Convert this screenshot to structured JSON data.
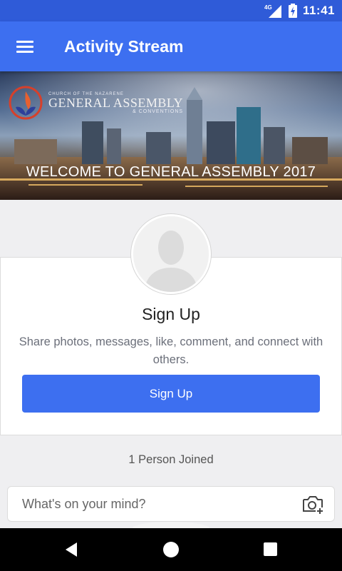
{
  "status_bar": {
    "network": "4G",
    "time": "11:41"
  },
  "app_bar": {
    "title": "Activity Stream",
    "menu_icon": "hamburger-menu-icon"
  },
  "banner": {
    "logo_top": "CHURCH OF THE NAZARENE",
    "logo_main": "GENERAL ASSEMBLY",
    "logo_sub": "& CONVENTIONS",
    "headline": "WELCOME TO GENERAL ASSEMBLY 2017"
  },
  "signup_card": {
    "title": "Sign Up",
    "description": "Share photos, messages, like, comment, and connect with others.",
    "button_label": "Sign Up"
  },
  "joined_text": "1 Person Joined",
  "composer": {
    "placeholder": "What's on your mind?",
    "icon": "add-photo-icon"
  },
  "nav_bar": {
    "buttons": [
      "back-icon",
      "home-icon",
      "recents-icon"
    ]
  },
  "colors": {
    "primary": "#3d6ff0",
    "status_bar": "#2f5bd8",
    "background": "#efeff1"
  }
}
